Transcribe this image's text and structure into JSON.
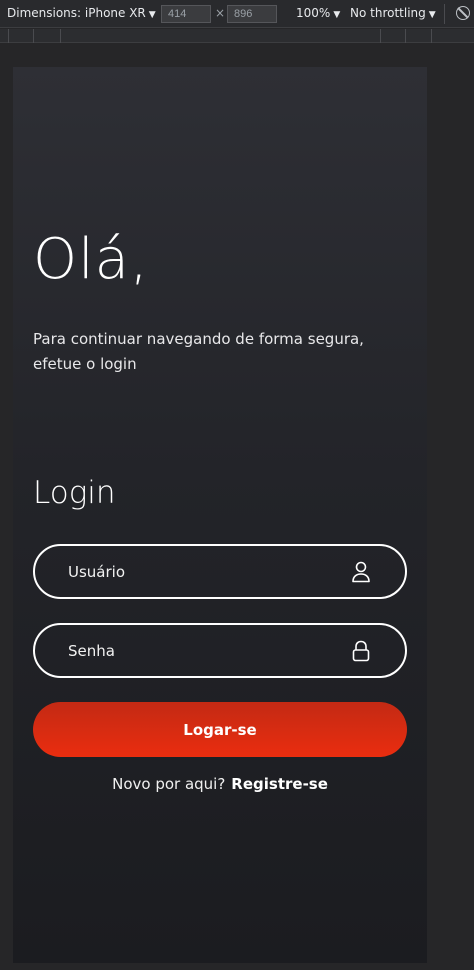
{
  "devtools": {
    "device_label": "Dimensions: iPhone XR",
    "width_value": "414",
    "height_value": "896",
    "times": "×",
    "zoom": "100%",
    "throttling": "No throttling",
    "caret": "▼"
  },
  "page": {
    "greeting": "Olá,",
    "intro": "Para continuar navegando de forma segura, efetue o login",
    "login_title": "Login",
    "username_placeholder": "Usuário",
    "password_placeholder": "Senha",
    "submit_label": "Logar-se",
    "signup_prompt": "Novo por aqui?",
    "signup_link": "Registre-se"
  },
  "icons": {
    "user": "user-icon",
    "lock": "lock-icon",
    "rotate": "no-entry-icon"
  },
  "colors": {
    "button_start": "#c32a14",
    "button_end": "#ea2d0f",
    "background": "#232429"
  }
}
